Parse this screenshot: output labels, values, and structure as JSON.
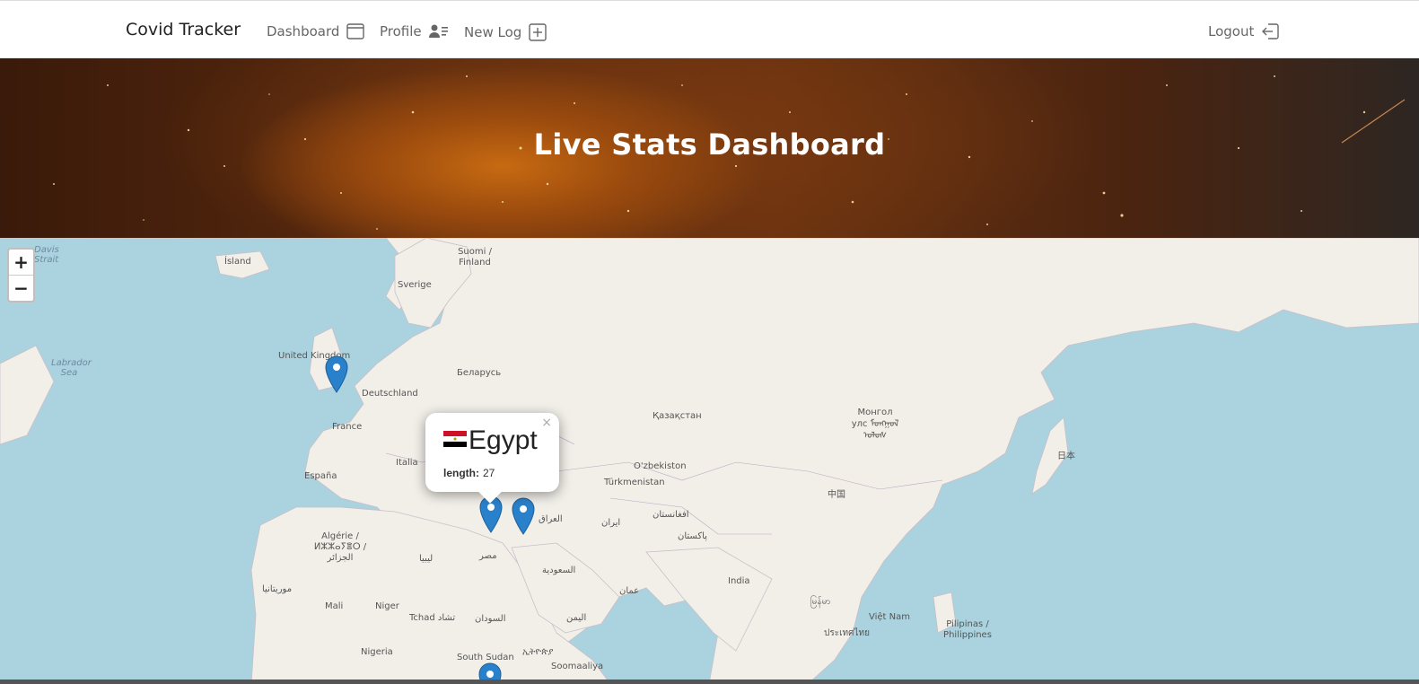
{
  "nav": {
    "brand": "Covid Tracker",
    "items": [
      {
        "label": "Dashboard",
        "icon": "window-icon"
      },
      {
        "label": "Profile",
        "icon": "user-list-icon"
      },
      {
        "label": "New Log",
        "icon": "plus-square-icon"
      }
    ],
    "logout": {
      "label": "Logout",
      "icon": "logout-icon"
    }
  },
  "hero": {
    "title": "Live Stats Dashboard"
  },
  "map": {
    "zoom_in": "+",
    "zoom_out": "−",
    "labels": [
      "Ísland",
      "Suomi / Finland",
      "Sverige",
      "United Kingdom",
      "Labrador Sea",
      "Davis Strait",
      "Беларусь",
      "Deutschland",
      "France",
      "España",
      "Italia",
      "Қазақстан",
      "Монгол улс ᠮᠤᠩᠭᠣᠯ ᠤᠯᠤᠰ",
      "O'zbekiston",
      "Türkmenistan",
      "中国",
      "日本",
      "افغانستان",
      "پاکستان",
      "ایران",
      "العراق",
      "السعودية",
      "مصر",
      "ليبيا",
      "Algérie / ⵍⵣⵣⴰⵢⴻⵔ / الجزائر",
      "موريتانيا",
      "Mali",
      "Niger",
      "Tchad تشاد",
      "السودان",
      "اليمن",
      "عمان",
      "India",
      "မြန်မာ",
      "Việt Nam",
      "ประเทศไทย",
      "Pilipinas / Philippines",
      "Nigeria",
      "South Sudan",
      "ኢትዮጵያ",
      "Soomaaliya"
    ],
    "popup": {
      "country": "Egypt",
      "flag_colors": [
        "#ce1126",
        "#ffffff",
        "#000000"
      ],
      "field_label": "length:",
      "field_value": "27",
      "close": "×"
    },
    "marker_color": "#2a81cb"
  }
}
